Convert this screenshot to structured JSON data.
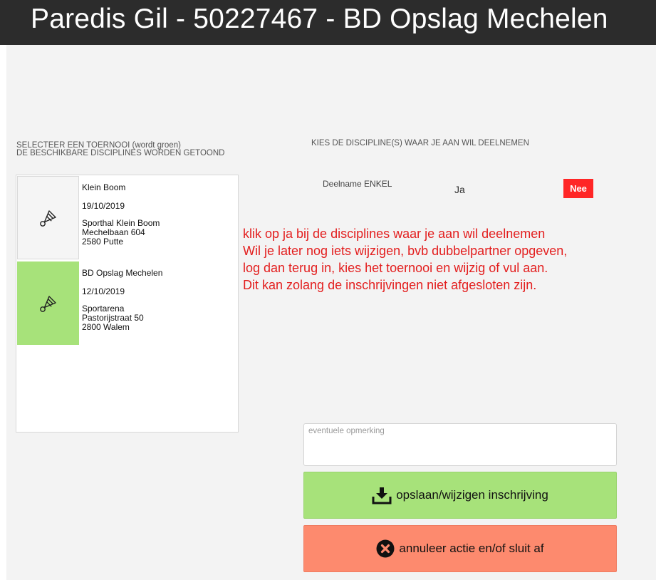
{
  "header": {
    "title": "Paredis Gil - 50227467 - BD Opslag Mechelen"
  },
  "left_header": {
    "line1": "SELECTEER EEN TOERNOOI (wordt groen)",
    "line2": "DE BESCHIKBARE DISCIPLINES WORDEN GETOOND"
  },
  "right_header": {
    "text": "KIES DE DISCIPLINE(S) WAAR JE AAN WIL DEELNEMEN"
  },
  "tournaments": [
    {
      "name": "Klein Boom",
      "date": "19/10/2019",
      "venue": "Sporthal Klein Boom",
      "street": "Mechelbaan 604",
      "city": "2580 Putte",
      "selected": false,
      "icon": "shuttlecock-icon"
    },
    {
      "name": "BD Opslag Mechelen",
      "date": "12/10/2019",
      "venue": "Sportarena",
      "street": "Pastorijstraat 50",
      "city": "2800 Walem",
      "selected": true,
      "icon": "shuttlecock-icon"
    }
  ],
  "discipline": {
    "label": "Deelname ENKEL",
    "yes": "Ja",
    "no": "Nee"
  },
  "info": {
    "line1": "klik op ja bij de disciplines waar je aan wil deelnemen",
    "line2": "Wil je later nog iets wijzigen, bvb dubbelpartner opgeven,",
    "line3": "log dan terug in, kies het toernooi en wijzig of vul aan.",
    "line4": "Dit kan zolang de inschrijvingen niet afgesloten zijn."
  },
  "remark": {
    "placeholder": "eventuele opmerking",
    "value": ""
  },
  "buttons": {
    "save": "opslaan/wijzigen inschrijving",
    "cancel": "annuleer actie en/of sluit af"
  },
  "colors": {
    "selected": "#a7e27a",
    "no_button": "#ff2626",
    "info_text": "#e31e1e",
    "save": "#a7e27a",
    "cancel": "#fd8a6e",
    "titlebar": "#2c2c2c"
  }
}
